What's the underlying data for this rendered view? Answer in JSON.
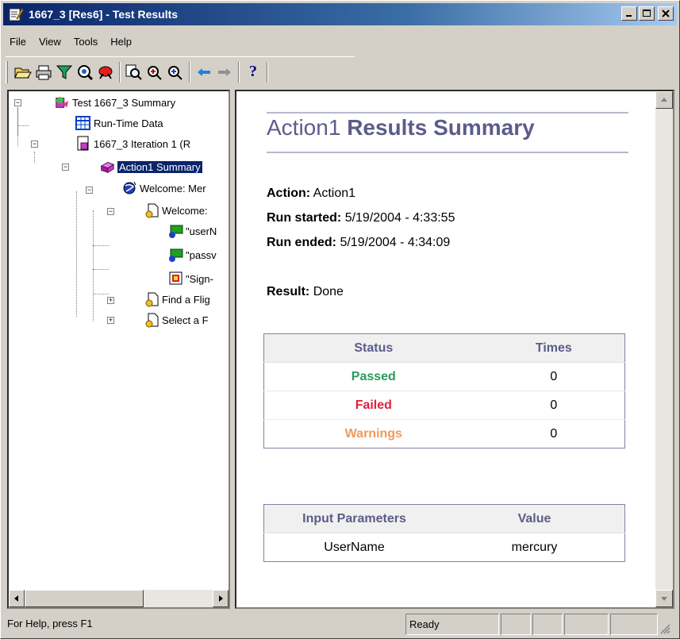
{
  "window": {
    "title": "1667_3 [Res6] - Test Results"
  },
  "menu": [
    "File",
    "View",
    "Tools",
    "Help"
  ],
  "toolbar": {
    "icons": [
      "open-icon",
      "print-icon",
      "filter-icon",
      "find-icon",
      "bug-icon",
      "zoom-icon",
      "zoom-in-icon",
      "zoom-out-icon",
      "back-arrow-icon",
      "forward-arrow-icon",
      "help-icon"
    ],
    "help_glyph": "?"
  },
  "tree": {
    "nodes": [
      {
        "label": "Test 1667_3 Summary",
        "icon": "test-summary-icon"
      },
      {
        "label": "Run-Time Data",
        "icon": "table-icon"
      },
      {
        "label": "1667_3 Iteration 1 (R",
        "icon": "iteration-icon"
      },
      {
        "label": "Action1 Summary",
        "icon": "action-icon",
        "selected": true
      },
      {
        "label": "Welcome: Mer",
        "icon": "browser-icon"
      },
      {
        "label": "Welcome:",
        "icon": "page-icon"
      },
      {
        "label": "\"userN",
        "icon": "edit-field-icon"
      },
      {
        "label": "\"passv",
        "icon": "edit-field-icon"
      },
      {
        "label": "\"Sign-",
        "icon": "image-icon"
      },
      {
        "label": "Find a Flig",
        "icon": "page-icon"
      },
      {
        "label": "Select a F",
        "icon": "page-icon"
      }
    ],
    "expander_minus": "−",
    "expander_plus": "+"
  },
  "summary": {
    "heading_prefix": "Action1",
    "heading_suffix": "Results Summary",
    "action_label": "Action:",
    "action_value": "Action1",
    "run_started_label": "Run started:",
    "run_started_value": "5/19/2004 - 4:33:55",
    "run_ended_label": "Run ended:",
    "run_ended_value": "5/19/2004 - 4:34:09",
    "result_label": "Result:",
    "result_value": "Done"
  },
  "status_table": {
    "headers": [
      "Status",
      "Times"
    ],
    "rows": [
      {
        "status": "Passed",
        "times": "0"
      },
      {
        "status": "Failed",
        "times": "0"
      },
      {
        "status": "Warnings",
        "times": "0"
      }
    ]
  },
  "params_table": {
    "headers": [
      "Input Parameters",
      "Value"
    ],
    "rows": [
      {
        "name": "UserName",
        "value": "mercury"
      }
    ]
  },
  "statusbar": {
    "help": "For Help, press F1",
    "state": "Ready"
  },
  "colors": {
    "passed": "#2a9a5a",
    "failed": "#e0203c",
    "warnings": "#f09a5a",
    "heading": "#5c5c8a",
    "titlebar": "#0a246a"
  }
}
